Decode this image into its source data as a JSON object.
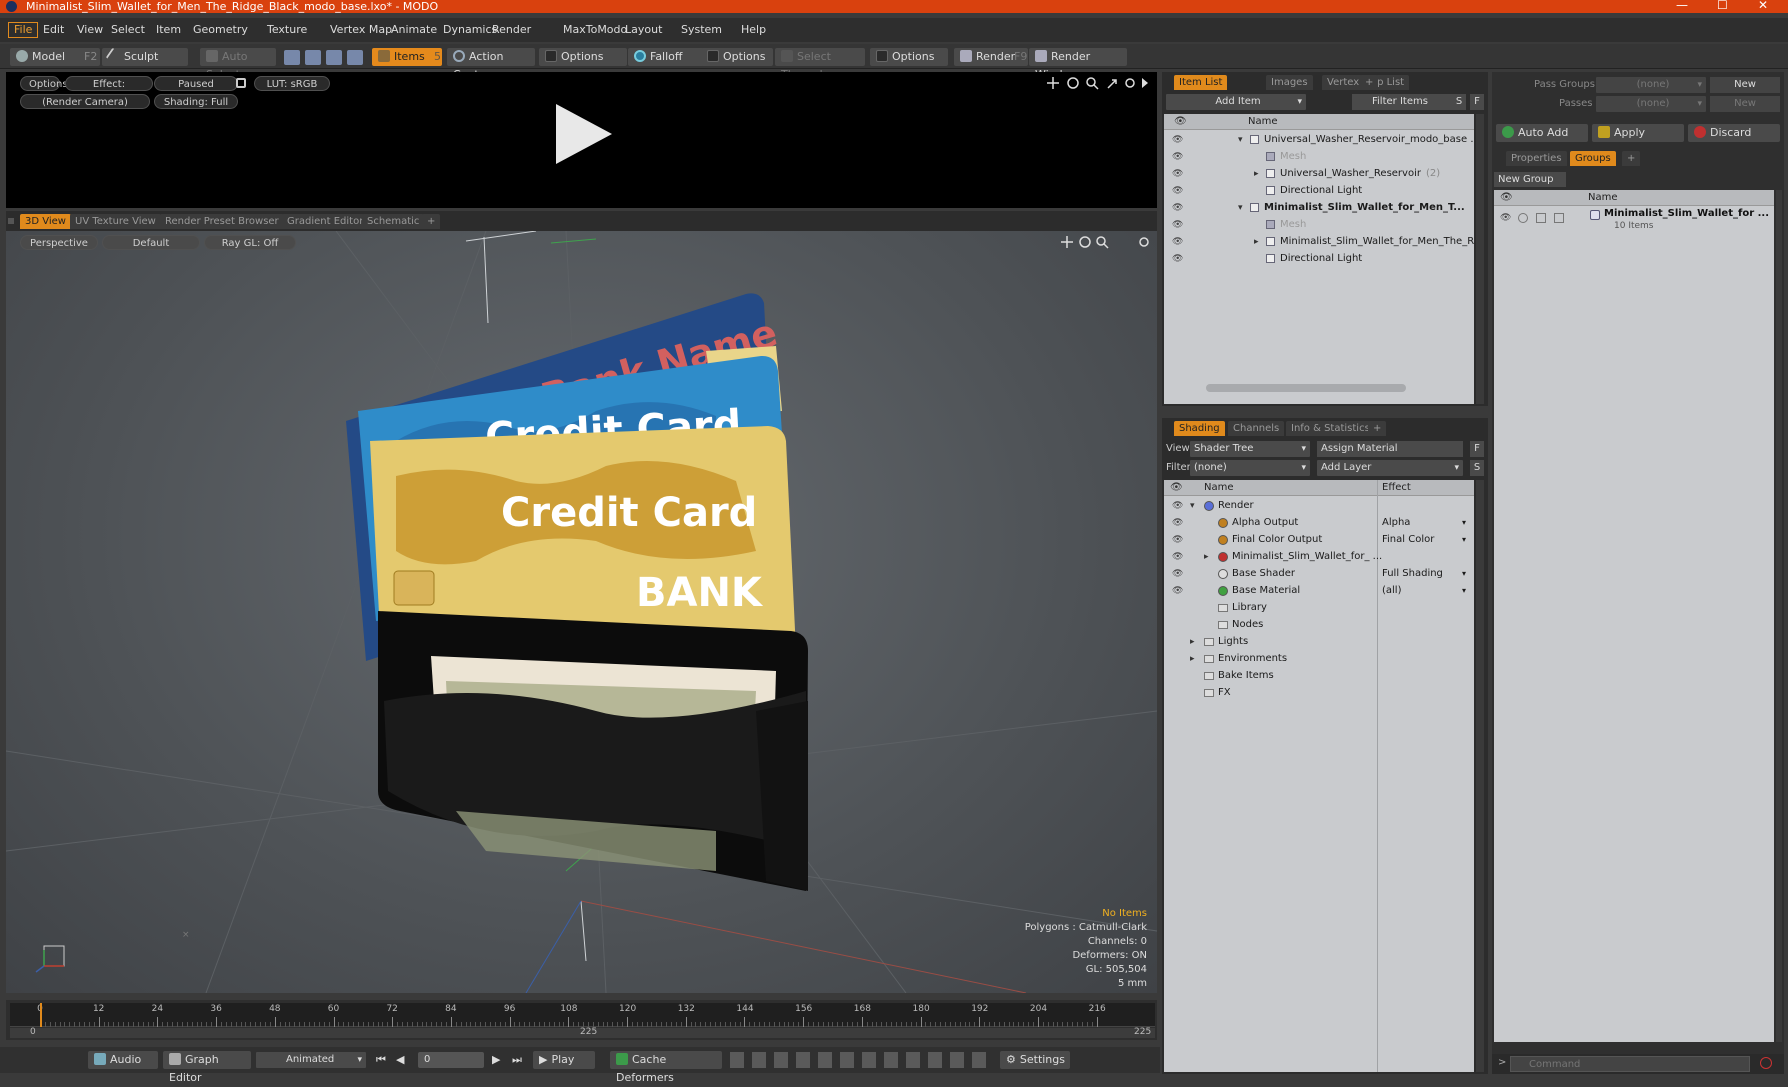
{
  "window": {
    "title": "Minimalist_Slim_Wallet_for_Men_The_Ridge_Black_modo_base.lxo* - MODO",
    "controls": [
      "—",
      "☐",
      "✕"
    ]
  },
  "menu": [
    "File",
    "Edit",
    "View",
    "Select",
    "Item",
    "Geometry",
    "Texture",
    "Vertex Map",
    "Animate",
    "Dynamics",
    "Render",
    "MaxToModo",
    "Layout",
    "System",
    "Help"
  ],
  "toolbar": {
    "model": "Model",
    "model_key": "F2",
    "sculpt": "Sculpt",
    "auto_select": "Auto Select",
    "items": "Items",
    "items_key": "5",
    "action_center": "Action Center",
    "options1": "Options",
    "falloff": "Falloff",
    "options2": "Options",
    "select_through": "Select Through",
    "options3": "Options",
    "render": "Render",
    "render_key": "F9",
    "render_window": "Render Window"
  },
  "preview": {
    "options": "Options",
    "effect": "Effect: (Shadi...",
    "paused": "Paused",
    "lut": "LUT: sRGB",
    "camera": "(Render Camera)",
    "shading": "Shading: Full"
  },
  "viewport_tabs": [
    "3D View",
    "UV Texture View",
    "Render Preset Browser",
    "Gradient Editor",
    "Schematic",
    "+"
  ],
  "viewport": {
    "projection": "Perspective",
    "style": "Default",
    "raygl": "Ray GL: Off",
    "info": [
      "No Items",
      "Polygons : Catmull-Clark",
      "Channels: 0",
      "Deformers: ON",
      "GL: 505,504",
      "5 mm"
    ]
  },
  "cards": {
    "back_text": "Bank Name",
    "mid_text": "Credit Card",
    "front_text": "Credit Card",
    "front_bank": "BANK"
  },
  "timeline": {
    "ticks": [
      "0",
      "12",
      "24",
      "36",
      "48",
      "60",
      "72",
      "84",
      "96",
      "108",
      "120",
      "132",
      "144",
      "156",
      "168",
      "180",
      "192",
      "204",
      "216"
    ],
    "start": "0",
    "mid": "225",
    "end": "225"
  },
  "bottom": {
    "audio": "Audio",
    "graph_editor": "Graph Editor",
    "animated": "Animated",
    "frame": "0",
    "play": "Play",
    "cache": "Cache Deformers",
    "settings": "Settings"
  },
  "itemlist": {
    "tabs": [
      "Item List",
      "Images",
      "Vertex Map List",
      "+"
    ],
    "add_item": "Add Item",
    "filter": "Filter Items",
    "s": "S",
    "f": "F",
    "col_name": "Name",
    "rows": [
      {
        "label": "Universal_Washer_Reservoir_modo_base ...",
        "indent": 0,
        "bold": false,
        "dim": false,
        "arrow": "▾"
      },
      {
        "label": "Mesh",
        "indent": 1,
        "bold": false,
        "dim": true,
        "arrow": ""
      },
      {
        "label": "Universal_Washer_Reservoir",
        "count": "(2)",
        "indent": 1,
        "bold": false,
        "dim": false,
        "arrow": "▸"
      },
      {
        "label": "Directional Light",
        "indent": 1,
        "bold": false,
        "dim": false,
        "arrow": ""
      },
      {
        "label": "Minimalist_Slim_Wallet_for_Men_T...",
        "indent": 0,
        "bold": true,
        "dim": false,
        "arrow": "▾"
      },
      {
        "label": "Mesh",
        "indent": 1,
        "bold": false,
        "dim": true,
        "arrow": ""
      },
      {
        "label": "Minimalist_Slim_Wallet_for_Men_The_Ri...",
        "indent": 1,
        "bold": false,
        "dim": false,
        "arrow": "▸"
      },
      {
        "label": "Directional Light",
        "indent": 1,
        "bold": false,
        "dim": false,
        "arrow": ""
      }
    ]
  },
  "shading": {
    "tabs": [
      "Shading",
      "Channels",
      "Info & Statistics",
      "+"
    ],
    "view_label": "View",
    "view_value": "Shader Tree",
    "assign": "Assign Material",
    "filter_label": "Filter",
    "filter_value": "(none)",
    "add_layer": "Add Layer",
    "f": "F",
    "s": "S",
    "col_name": "Name",
    "col_effect": "Effect",
    "rows": [
      {
        "label": "Render",
        "effect": "",
        "indent": 0,
        "arrow": "▾",
        "eye": true,
        "color": "#5a6fd8"
      },
      {
        "label": "Alpha Output",
        "effect": "Alpha",
        "indent": 1,
        "arrow": "",
        "eye": true,
        "color": "#c08020"
      },
      {
        "label": "Final Color Output",
        "effect": "Final Color",
        "indent": 1,
        "arrow": "",
        "eye": true,
        "color": "#c08020"
      },
      {
        "label": "Minimalist_Slim_Wallet_for_ ...",
        "effect": "",
        "indent": 1,
        "arrow": "▸",
        "eye": true,
        "color": "#c03030"
      },
      {
        "label": "Base Shader",
        "effect": "Full Shading",
        "indent": 1,
        "arrow": "",
        "eye": true,
        "color": "#dddddd"
      },
      {
        "label": "Base Material",
        "effect": "(all)",
        "indent": 1,
        "arrow": "",
        "eye": true,
        "color": "#40a040"
      },
      {
        "label": "Library",
        "effect": "",
        "indent": 1,
        "arrow": "",
        "eye": false,
        "color": ""
      },
      {
        "label": "Nodes",
        "effect": "",
        "indent": 1,
        "arrow": "",
        "eye": false,
        "color": ""
      },
      {
        "label": "Lights",
        "effect": "",
        "indent": 0,
        "arrow": "▸",
        "eye": false,
        "color": ""
      },
      {
        "label": "Environments",
        "effect": "",
        "indent": 0,
        "arrow": "▸",
        "eye": false,
        "color": ""
      },
      {
        "label": "Bake Items",
        "effect": "",
        "indent": 0,
        "arrow": "",
        "eye": false,
        "color": ""
      },
      {
        "label": "FX",
        "effect": "",
        "indent": 0,
        "arrow": "",
        "eye": false,
        "color": ""
      }
    ]
  },
  "groups": {
    "pass_groups": "Pass Groups",
    "pass_value": "(none)",
    "new": "New",
    "passes": "Passes",
    "passes_value": "(none)",
    "new2": "New",
    "auto_add": "Auto Add",
    "apply": "Apply",
    "discard": "Discard",
    "tabs": [
      "Properties",
      "Groups",
      "+"
    ],
    "new_group": "New Group",
    "col_name": "Name",
    "group_name": "Minimalist_Slim_Wallet_for ...",
    "group_items": "10 Items"
  },
  "command": {
    "placeholder": "Command"
  }
}
